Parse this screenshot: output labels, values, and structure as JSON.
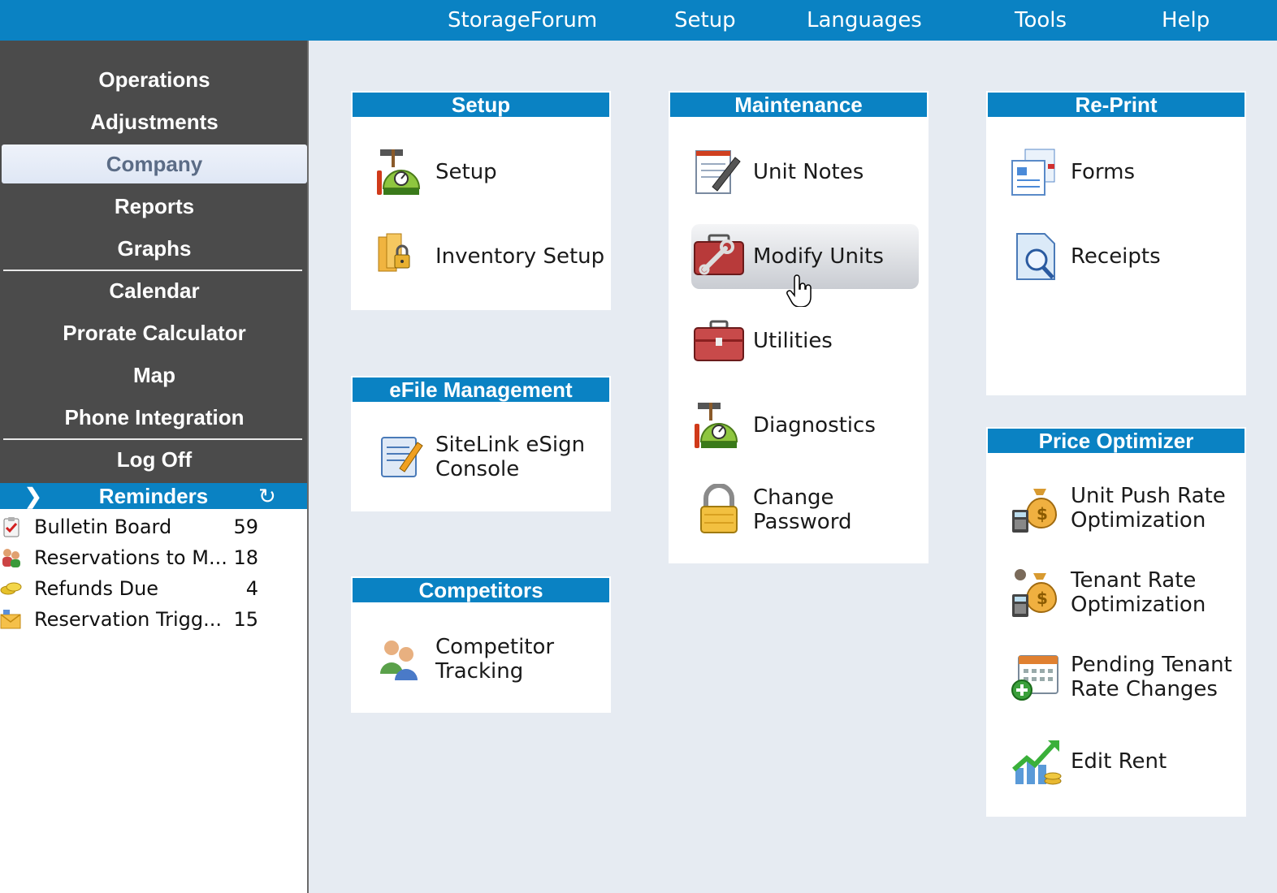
{
  "top_menu": [
    "StorageForum",
    "Setup",
    "Languages",
    "Tools",
    "Help"
  ],
  "left_nav": {
    "items": [
      "Operations",
      "Adjustments",
      "Company",
      "Reports",
      "Graphs",
      "Calendar",
      "Prorate Calculator",
      "Map",
      "Phone Integration",
      "Log Off"
    ],
    "active": "Company"
  },
  "reminders": {
    "title": "Reminders",
    "items": [
      {
        "label": "Bulletin Board",
        "count": "59",
        "icon": "clipboard-check-icon"
      },
      {
        "label": "Reservations to M...",
        "count": "18",
        "icon": "people-icon"
      },
      {
        "label": "Refunds Due",
        "count": "4",
        "icon": "coins-icon"
      },
      {
        "label": "Reservation Trigg...",
        "count": "15",
        "icon": "envelope-icon"
      }
    ]
  },
  "panels": {
    "setup": {
      "title": "Setup",
      "items": [
        "Setup",
        "Inventory Setup"
      ]
    },
    "efile": {
      "title": "eFile Management",
      "items": [
        [
          "SiteLink eSign",
          "Console"
        ]
      ]
    },
    "competitors": {
      "title": "Competitors",
      "items": [
        [
          "Competitor",
          "Tracking"
        ]
      ]
    },
    "maintenance": {
      "title": "Maintenance",
      "items": [
        "Unit Notes",
        "Modify Units",
        "Utilities",
        "Diagnostics",
        [
          "Change",
          "Password"
        ]
      ]
    },
    "reprint": {
      "title": "Re-Print",
      "items": [
        "Forms",
        "Receipts"
      ]
    },
    "price_optimizer": {
      "title": "Price Optimizer",
      "items": [
        [
          "Unit Push Rate",
          "Optimization"
        ],
        [
          "Tenant Rate",
          "Optimization"
        ],
        [
          "Pending Tenant",
          "Rate Changes"
        ],
        "Edit Rent"
      ]
    }
  },
  "colors": {
    "brand_blue": "#0a82c3",
    "nav_bg": "#4b4b4b",
    "main_bg": "#e6ebf2"
  }
}
